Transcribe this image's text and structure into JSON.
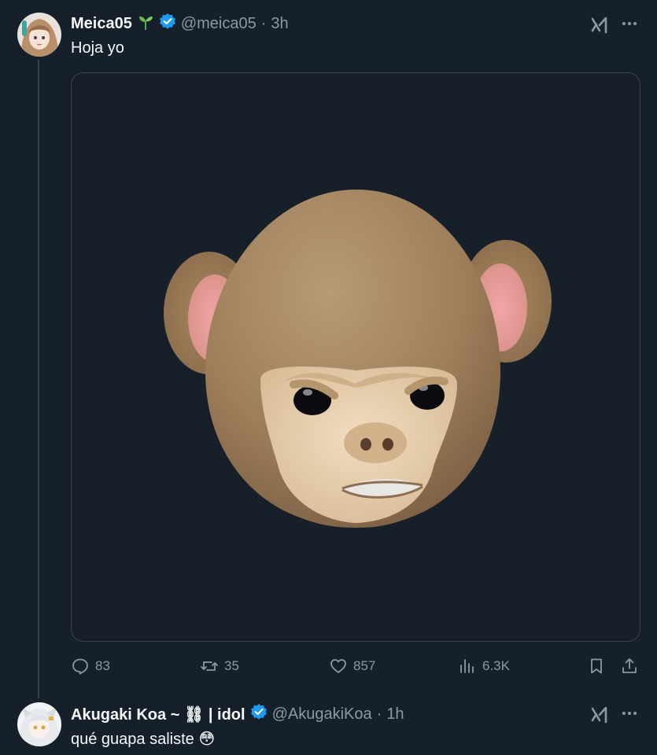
{
  "tweet1": {
    "display_name": "Meica05",
    "handle": "@meica05",
    "time": "3h",
    "text": "Hoja yo",
    "stats": {
      "replies": "83",
      "reposts": "35",
      "likes": "857",
      "views": "6.3K"
    },
    "media_icon": "animoji-monkey-image"
  },
  "tweet2": {
    "display_name": "Akugaki Koa ~ ⛓ | idol",
    "handle": "@AkugakiKoa",
    "time": "1h",
    "text": "qué guapa saliste 😳"
  },
  "icons": {
    "grok": "grok-icon",
    "more": "more-icon",
    "reply": "reply-icon",
    "repost": "repost-icon",
    "like": "heart-icon",
    "views": "views-icon",
    "bookmark": "bookmark-icon",
    "share": "share-icon"
  },
  "colors": {
    "background": "#15202b",
    "muted": "#8b98a5",
    "verified": "#1d9bf0",
    "border": "#38444d"
  }
}
